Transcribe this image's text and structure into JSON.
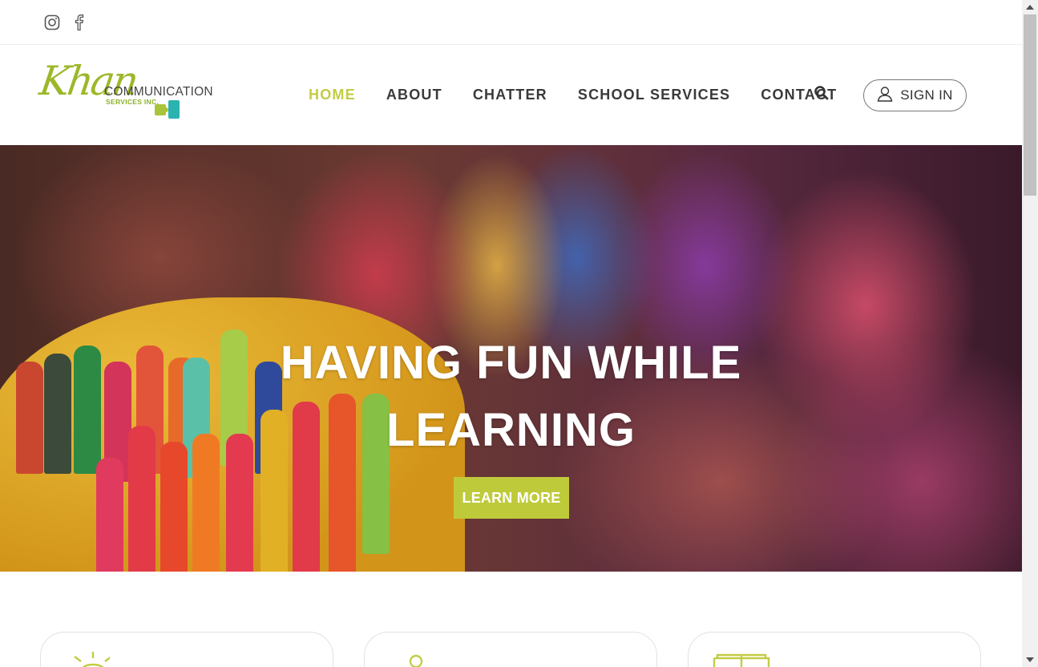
{
  "social": {
    "instagram_icon": "instagram-icon",
    "facebook_icon": "facebook-icon"
  },
  "logo": {
    "khan": "Khan",
    "communication": "COMMUNICATION",
    "services": "SERVICES INC."
  },
  "nav": {
    "items": [
      {
        "label": "HOME",
        "active": true
      },
      {
        "label": "ABOUT",
        "active": false
      },
      {
        "label": "CHATTER",
        "active": false
      },
      {
        "label": "SCHOOL SERVICES",
        "active": false
      },
      {
        "label": "CONTACT",
        "active": false
      }
    ],
    "search_icon": "search-icon",
    "signin_label": "SIGN IN"
  },
  "hero": {
    "title_line1": "HAVING FUN WHILE",
    "title_line2": "LEARNING",
    "cta_label": "LEARN MORE"
  },
  "cards": {
    "icons": [
      "lightbulb-icon",
      "person-icon",
      "book-icon"
    ]
  },
  "colors": {
    "accent": "#bfca3a",
    "brand_green": "#9cb82a",
    "nav_text": "#3a3a3a"
  }
}
